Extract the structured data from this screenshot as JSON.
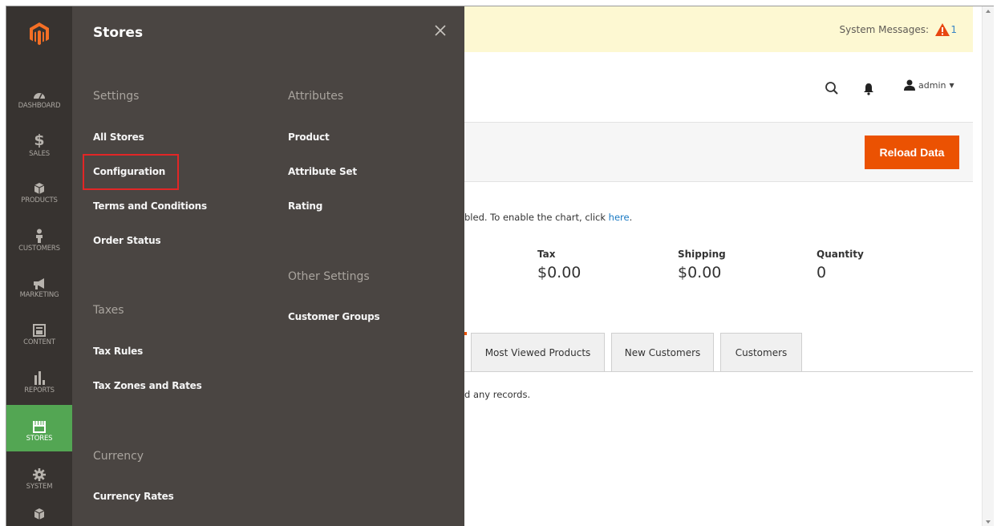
{
  "nav": {
    "items": [
      {
        "label": "DASHBOARD",
        "icon": "dashboard-icon"
      },
      {
        "label": "SALES",
        "icon": "dollar-icon"
      },
      {
        "label": "PRODUCTS",
        "icon": "cube-icon"
      },
      {
        "label": "CUSTOMERS",
        "icon": "person-icon"
      },
      {
        "label": "MARKETING",
        "icon": "megaphone-icon"
      },
      {
        "label": "CONTENT",
        "icon": "content-icon"
      },
      {
        "label": "REPORTS",
        "icon": "bar-chart-icon"
      },
      {
        "label": "STORES",
        "icon": "storefront-icon"
      },
      {
        "label": "SYSTEM",
        "icon": "gear-icon"
      }
    ],
    "active": "STORES"
  },
  "flyout": {
    "title": "Stores",
    "settings": {
      "heading": "Settings",
      "links": [
        "All Stores",
        "Configuration",
        "Terms and Conditions",
        "Order Status"
      ]
    },
    "taxes": {
      "heading": "Taxes",
      "links": [
        "Tax Rules",
        "Tax Zones and Rates"
      ]
    },
    "currency": {
      "heading": "Currency",
      "links": [
        "Currency Rates"
      ]
    },
    "attributes": {
      "heading": "Attributes",
      "links": [
        "Product",
        "Attribute Set",
        "Rating"
      ]
    },
    "other": {
      "heading": "Other Settings",
      "links": [
        "Customer Groups"
      ]
    },
    "highlighted_link": "Configuration"
  },
  "system_messages": {
    "label": "System Messages:",
    "count": "1"
  },
  "header": {
    "user": "admin"
  },
  "actions": {
    "reload": "Reload Data"
  },
  "chart_notice": {
    "text": "bled. To enable the chart, click ",
    "link": "here",
    "suffix": "."
  },
  "totals": [
    {
      "label": "Tax",
      "value": "$0.00"
    },
    {
      "label": "Shipping",
      "value": "$0.00"
    },
    {
      "label": "Quantity",
      "value": "0"
    }
  ],
  "tabs": [
    "Most Viewed Products",
    "New Customers",
    "Customers"
  ],
  "no_records": "d any records.",
  "colors": {
    "nav_bg": "#373330",
    "flyout_bg": "#4a4542",
    "active": "#53a653",
    "accent": "#eb5202",
    "highlight": "#e22626"
  }
}
